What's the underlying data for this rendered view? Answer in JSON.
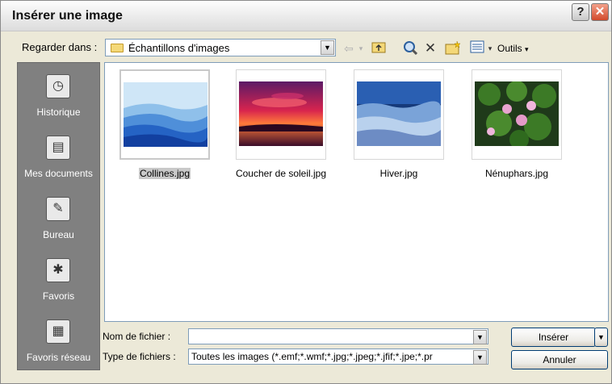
{
  "window": {
    "title": "Insérer une image",
    "help_glyph": "?",
    "close_glyph": "✕"
  },
  "toolbar": {
    "lookin_label": "Regarder dans :",
    "lookin_value": "Échantillons d'images",
    "outils_label": "Outils",
    "back_icon": "back-arrow-icon",
    "up_icon": "up-folder-icon",
    "search_icon": "search-web-icon",
    "delete_icon": "delete-icon",
    "new_folder_icon": "new-folder-icon",
    "views_icon": "views-icon"
  },
  "places": [
    {
      "label": "Historique",
      "icon": "history-icon",
      "glyph": "◷"
    },
    {
      "label": "Mes documents",
      "icon": "my-documents-icon",
      "glyph": "▤"
    },
    {
      "label": "Bureau",
      "icon": "desktop-icon",
      "glyph": "✎"
    },
    {
      "label": "Favoris",
      "icon": "favorites-icon",
      "glyph": "✱"
    },
    {
      "label": "Favoris réseau",
      "icon": "network-icon",
      "glyph": "▦"
    }
  ],
  "files": [
    {
      "name": "Collines.jpg",
      "selected": true
    },
    {
      "name": "Coucher de soleil.jpg",
      "selected": false
    },
    {
      "name": "Hiver.jpg",
      "selected": false
    },
    {
      "name": "Nénuphars.jpg",
      "selected": false
    }
  ],
  "form": {
    "filename_label": "Nom de fichier :",
    "filename_value": "",
    "filetype_label": "Type de fichiers :",
    "filetype_value": "Toutes les images (*.emf;*.wmf;*.jpg;*.jpeg;*.jfif;*.jpe;*.pr"
  },
  "buttons": {
    "insert": "Insérer",
    "cancel": "Annuler"
  }
}
